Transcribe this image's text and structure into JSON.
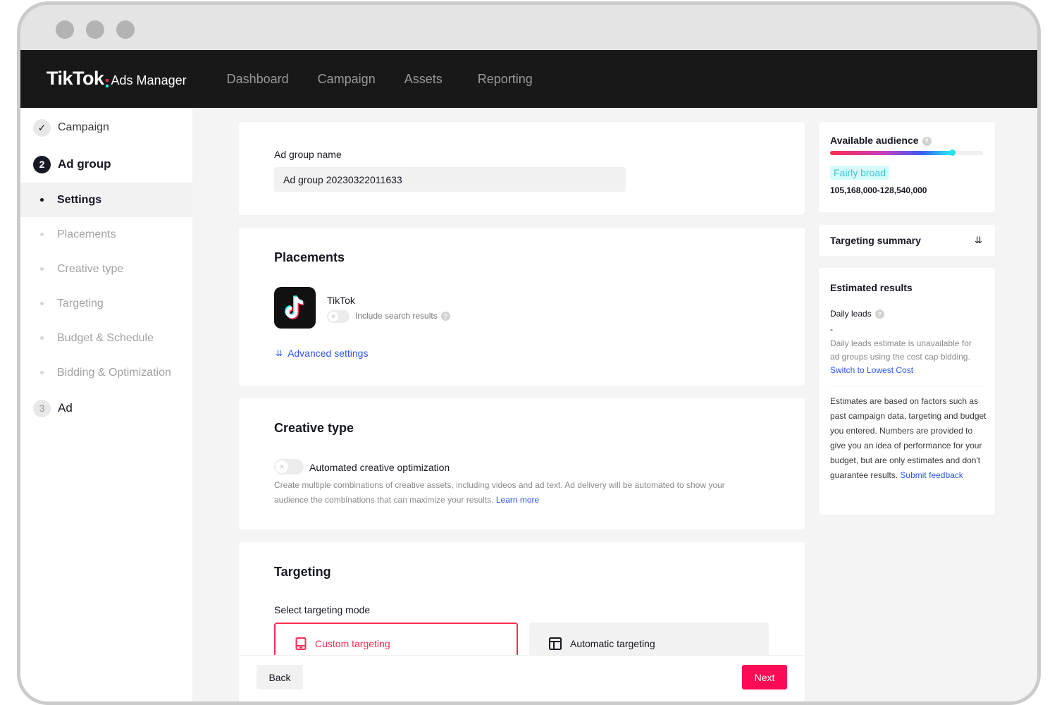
{
  "window": {
    "controls": [
      "close",
      "minimize",
      "maximize"
    ]
  },
  "topnav": {
    "logo_main": "TikTok",
    "logo_sub": "Ads Manager",
    "items": [
      {
        "label": "Dashboard"
      },
      {
        "label": "Campaign"
      },
      {
        "label": "Assets"
      },
      {
        "label": "Reporting"
      }
    ]
  },
  "sidebar": {
    "steps": [
      {
        "marker": "✓",
        "label": "Campaign",
        "state": "done"
      },
      {
        "marker": "2",
        "label": "Ad group",
        "state": "active"
      },
      {
        "marker": "3",
        "label": "Ad",
        "state": "pending"
      }
    ],
    "substeps": [
      {
        "label": "Settings",
        "current": true
      },
      {
        "label": "Placements"
      },
      {
        "label": "Creative type"
      },
      {
        "label": "Targeting"
      },
      {
        "label": "Budget & Schedule"
      },
      {
        "label": "Bidding & Optimization"
      }
    ]
  },
  "main": {
    "adgroup": {
      "label": "Ad group name",
      "value": "Ad group 20230322011633"
    },
    "placements": {
      "title": "Placements",
      "platform": "TikTok",
      "search_toggle_label": "Include search results",
      "search_toggle_on": false,
      "advanced_link": "Advanced settings"
    },
    "creative": {
      "title": "Creative type",
      "toggle_label": "Automated creative optimization",
      "toggle_on": false,
      "description": "Create multiple combinations of creative assets, including videos and ad text. Ad delivery will be automated to show your audience the combinations that can maximize your results.",
      "learn_more": "Learn more"
    },
    "targeting": {
      "title": "Targeting",
      "mode_label": "Select targeting mode",
      "modes": [
        {
          "label": "Custom targeting",
          "icon": "device-icon",
          "selected": true
        },
        {
          "label": "Automatic targeting",
          "icon": "layout-icon",
          "selected": false
        }
      ]
    },
    "actions": {
      "back": "Back",
      "next": "Next"
    }
  },
  "right": {
    "audience": {
      "title": "Available audience",
      "level_fraction": 0.8,
      "badge": "Fairly broad",
      "range": "105,168,000-128,540,000"
    },
    "targeting_summary": {
      "title": "Targeting summary"
    },
    "estimated": {
      "title": "Estimated results",
      "metric": "Daily leads",
      "value": "-",
      "note": "Daily leads estimate is unavailable for ad groups using the cost cap bidding.",
      "note_link": "Switch to Lowest Cost",
      "disclaimer": "Estimates are based on factors such as past campaign data, targeting and budget you entered. Numbers are provided to give you an idea of performance for your budget, but are only estimates and don't guarantee results.",
      "disclaimer_link": "Submit feedback"
    }
  },
  "colors": {
    "brand_pink": "#fe2c55",
    "brand_cyan": "#25f4ee",
    "link_blue": "#2c57f5",
    "nav_bg": "#181818"
  }
}
